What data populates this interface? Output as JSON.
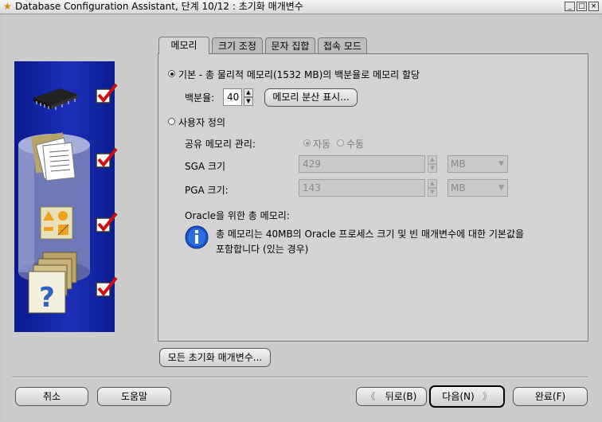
{
  "window": {
    "title": "Database Configuration Assistant, 단계 10/12 : 초기화 매개변수"
  },
  "tabs": [
    {
      "label": "메모리"
    },
    {
      "label": "크기 조정"
    },
    {
      "label": "문자 집합"
    },
    {
      "label": "접속 모드"
    }
  ],
  "memory": {
    "typical_label": "기본 - 총 물리적 메모리(1532 MB)의 백분율로 메모리 할당",
    "percent_label": "백분율:",
    "percent_value": "40",
    "show_distribution_button": "메모리 분산 표시...",
    "custom_label": "사용자 정의",
    "shared_mgmt_label": "공유 메모리 관리:",
    "auto_label": "자동",
    "manual_label": "수동",
    "sga_label": "SGA 크기",
    "sga_value": "429",
    "sga_unit": "MB",
    "pga_label": "PGA 크기:",
    "pga_value": "143",
    "pga_unit": "MB",
    "total_label": "Oracle을 위한 총 메모리:",
    "info_text_line1": "총 메모리는 40MB의 Oracle 프로세스 크기 및 빈 매개변수에 대한 기본값을",
    "info_text_line2": "포함합니다 (있는 경우)"
  },
  "all_params_button": "모든 초기화 매개변수...",
  "footer": {
    "cancel": "취소",
    "help": "도움말",
    "back": "뒤로(B)",
    "next": "다음(N)",
    "finish": "완료(F)"
  },
  "colors": {
    "panel_blue": "#1426a8",
    "check_red": "#d01010",
    "info_blue": "#1a55c8"
  }
}
